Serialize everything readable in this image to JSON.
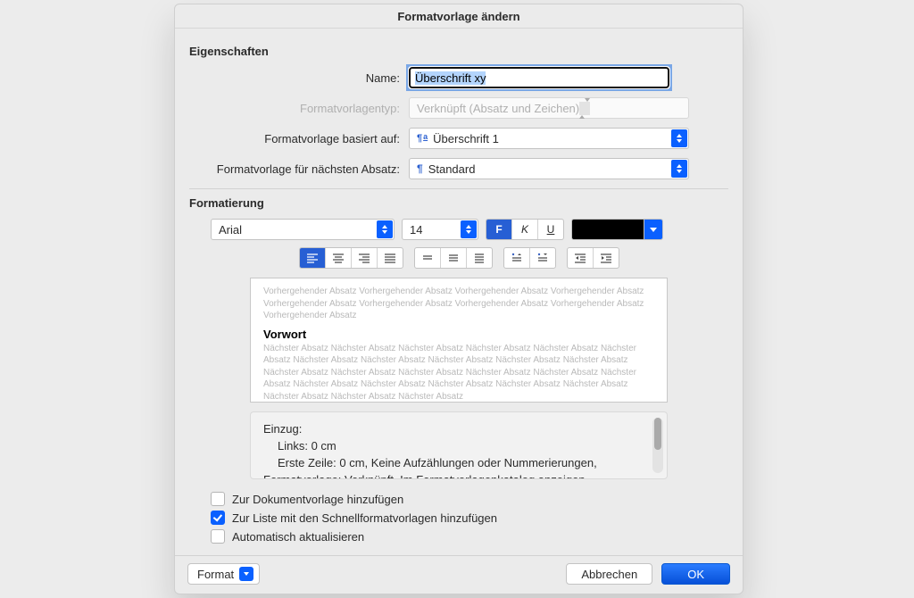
{
  "dialog_title": "Formatvorlage ändern",
  "section_props": "Eigenschaften",
  "labels": {
    "name": "Name:",
    "type": "Formatvorlagentyp:",
    "based_on": "Formatvorlage basiert auf:",
    "next": "Formatvorlage für nächsten Absatz:"
  },
  "fields": {
    "name_value": "Überschrift xy",
    "type_value": "Verknüpft (Absatz und Zeichen)",
    "based_on_value": "Überschrift 1",
    "next_value": "Standard"
  },
  "section_fmt": "Formatierung",
  "font": {
    "family": "Arial",
    "size": "14",
    "bold_label": "F",
    "italic_label": "K",
    "underline_label": "U"
  },
  "preview": {
    "prev_para": "Vorhergehender Absatz Vorhergehender Absatz Vorhergehender Absatz Vorhergehender Absatz Vorhergehender Absatz Vorhergehender Absatz Vorhergehender Absatz Vorhergehender Absatz Vorhergehender Absatz",
    "sample": "Vorwort",
    "next_para": "Nächster Absatz Nächster Absatz Nächster Absatz Nächster Absatz Nächster Absatz Nächster Absatz Nächster Absatz Nächster Absatz Nächster Absatz Nächster Absatz Nächster Absatz Nächster Absatz Nächster Absatz Nächster Absatz Nächster Absatz Nächster Absatz Nächster Absatz Nächster Absatz Nächster Absatz Nächster Absatz Nächster Absatz Nächster Absatz Nächster Absatz Nächster Absatz Nächster Absatz"
  },
  "description": {
    "l1": "Einzug:",
    "l2": "Links:  0 cm",
    "l3": "Erste Zeile:  0 cm,  Keine Aufzählungen oder Nummerierungen,",
    "l4": "Formatvorlage: Verknüpft, Im Formatvorlagenkatalog anzeigen"
  },
  "checks": {
    "add_template": "Zur Dokumentvorlage hinzufügen",
    "quick_styles": "Zur Liste mit den Schnellformatvorlagen hinzufügen",
    "auto_update": "Automatisch aktualisieren"
  },
  "footer": {
    "format": "Format",
    "cancel": "Abbrechen",
    "ok": "OK"
  },
  "colors": {
    "text_color": "#000000"
  }
}
